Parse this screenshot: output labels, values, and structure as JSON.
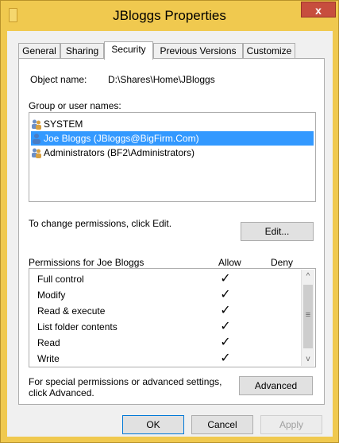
{
  "window": {
    "title": "JBloggs Properties",
    "close_glyph": "x",
    "accent_color": "#f0c94f",
    "title_icon": "folder-icon"
  },
  "tabs": [
    {
      "label": "General",
      "active": false
    },
    {
      "label": "Sharing",
      "active": false
    },
    {
      "label": "Security",
      "active": true
    },
    {
      "label": "Previous Versions",
      "active": false
    },
    {
      "label": "Customize",
      "active": false
    }
  ],
  "security": {
    "object_name_label": "Object name:",
    "object_name_value": "D:\\Shares\\Home\\JBloggs",
    "group_label": "Group or user names:",
    "groups": [
      {
        "name": "SYSTEM",
        "icon": "group-users-icon",
        "selected": false
      },
      {
        "name": "Joe Bloggs (JBloggs@BigFirm.Com)",
        "icon": "user-icon",
        "selected": true
      },
      {
        "name": "Administrators (BF2\\Administrators)",
        "icon": "group-users-icon",
        "selected": false
      }
    ],
    "change_text": "To change permissions, click Edit.",
    "edit_button": "Edit...",
    "permissions_header": "Permissions for Joe Bloggs",
    "allow_header": "Allow",
    "deny_header": "Deny",
    "check_glyph": "✓",
    "permissions": [
      {
        "name": "Full control",
        "allow": true,
        "deny": false
      },
      {
        "name": "Modify",
        "allow": true,
        "deny": false
      },
      {
        "name": "Read & execute",
        "allow": true,
        "deny": false
      },
      {
        "name": "List folder contents",
        "allow": true,
        "deny": false
      },
      {
        "name": "Read",
        "allow": true,
        "deny": false
      },
      {
        "name": "Write",
        "allow": true,
        "deny": false
      }
    ],
    "advanced_text_line1": "For special permissions or advanced settings,",
    "advanced_text_line2": "click Advanced.",
    "advanced_button": "Advanced"
  },
  "scrollbar": {
    "up": "^",
    "down": "v",
    "grip": "≡"
  },
  "footer": {
    "ok": "OK",
    "cancel": "Cancel",
    "apply": "Apply",
    "apply_enabled": false
  }
}
